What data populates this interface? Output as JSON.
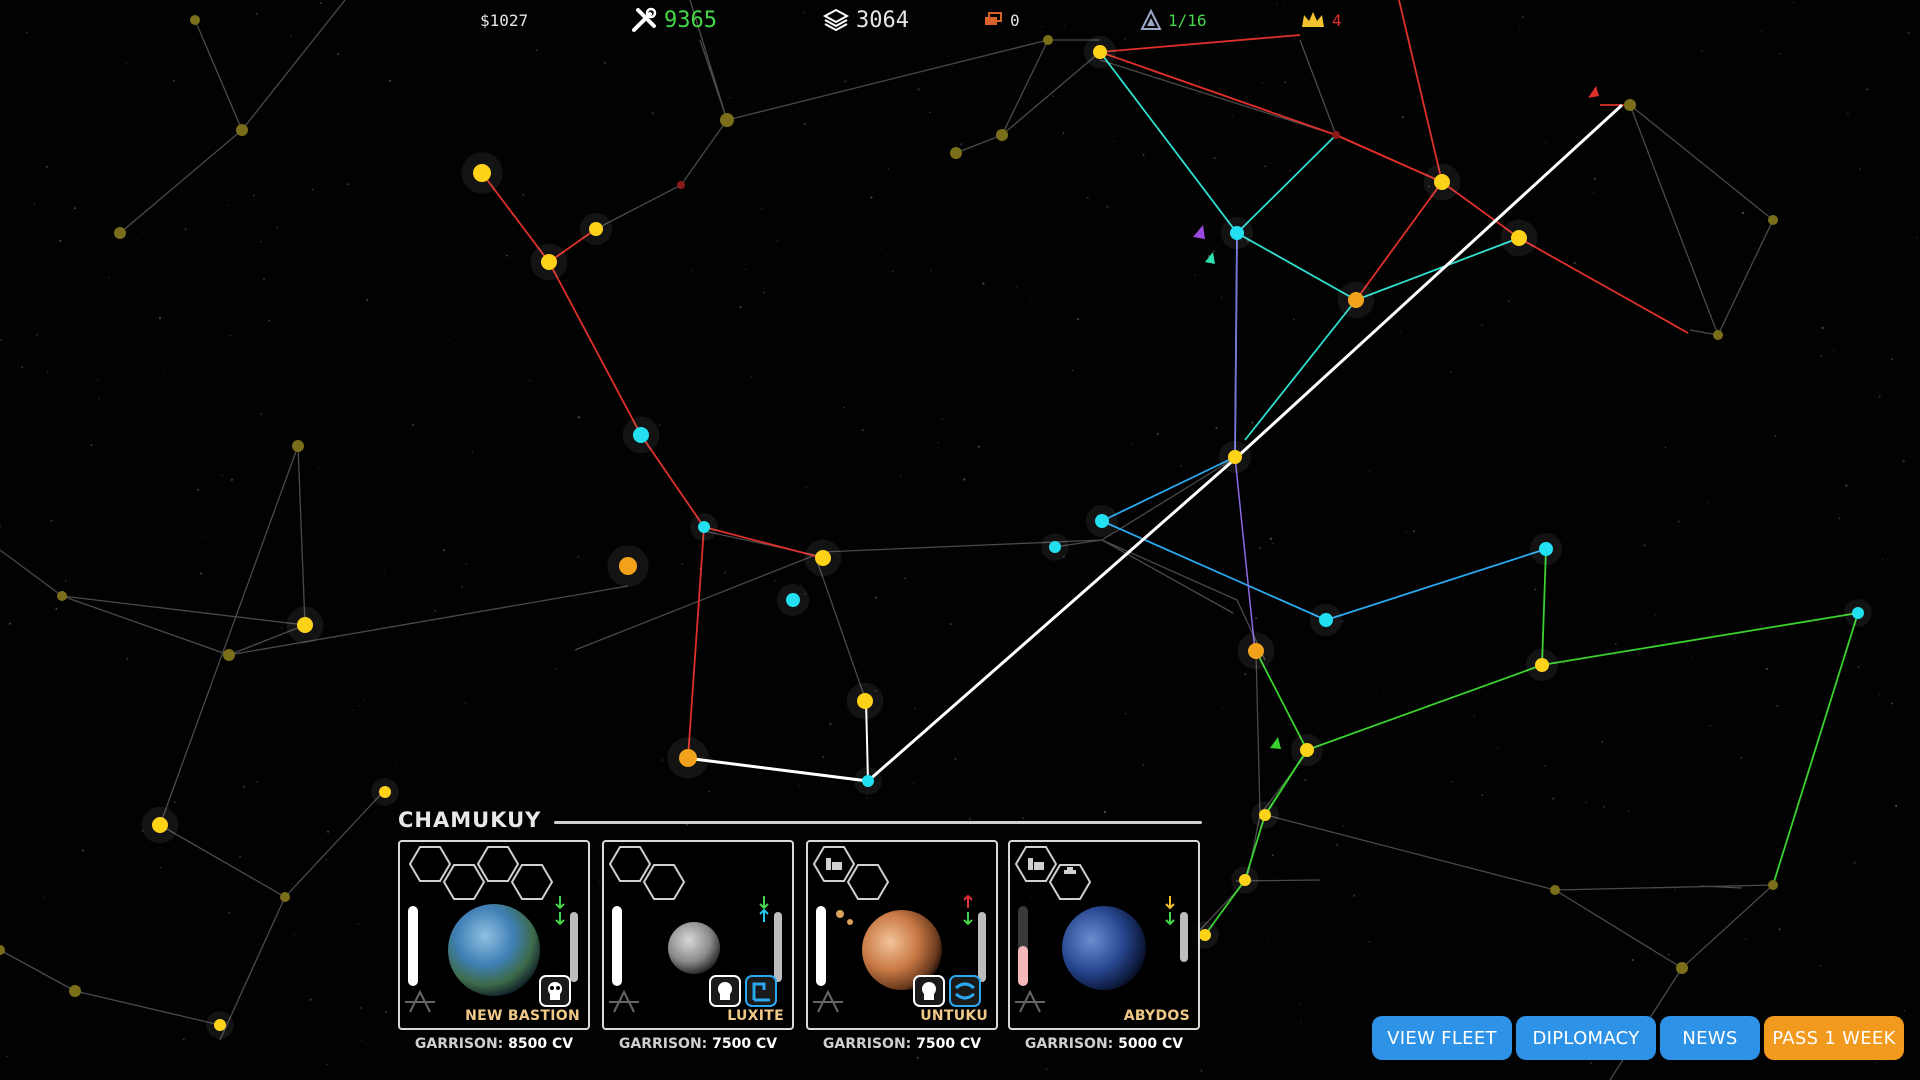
{
  "hud": {
    "money": "$1027",
    "industry": "9365",
    "materials": "3064",
    "ships": "0",
    "fleets": "1/16",
    "influence": "4",
    "colors": {
      "money": "#e6e6e6",
      "industry": "#45d64a",
      "materials": "#e6e6e6",
      "ships": "#e6e6e6",
      "fleets": "#45d64a",
      "influence": "#e03030"
    }
  },
  "system": {
    "name": "CHAMUKUY",
    "garrison_label": "GARRISON:",
    "planets": [
      {
        "name": "NEW BASTION",
        "garrison": "8500 CV",
        "type": "earth"
      },
      {
        "name": "LUXITE",
        "garrison": "7500 CV",
        "type": "moon"
      },
      {
        "name": "UNTUKU",
        "garrison": "7500 CV",
        "type": "mars"
      },
      {
        "name": "ABYDOS",
        "garrison": "5000 CV",
        "type": "ocean"
      }
    ]
  },
  "buttons": {
    "view_fleet": "VIEW FLEET",
    "diplomacy": "DIPLOMACY",
    "news": "NEWS",
    "pass_week": "PASS 1 WEEK"
  },
  "colors": {
    "button_blue": "#2e93e6",
    "button_orange": "#f29a1d",
    "route_red": "#e0302a",
    "route_cyan": "#2fe0d0",
    "route_green": "#3ad22e",
    "route_blue": "#2aa8f0",
    "route_selected": "#ffffff",
    "star_yellow": "#ffd21a",
    "star_cyan": "#22e0f0"
  }
}
